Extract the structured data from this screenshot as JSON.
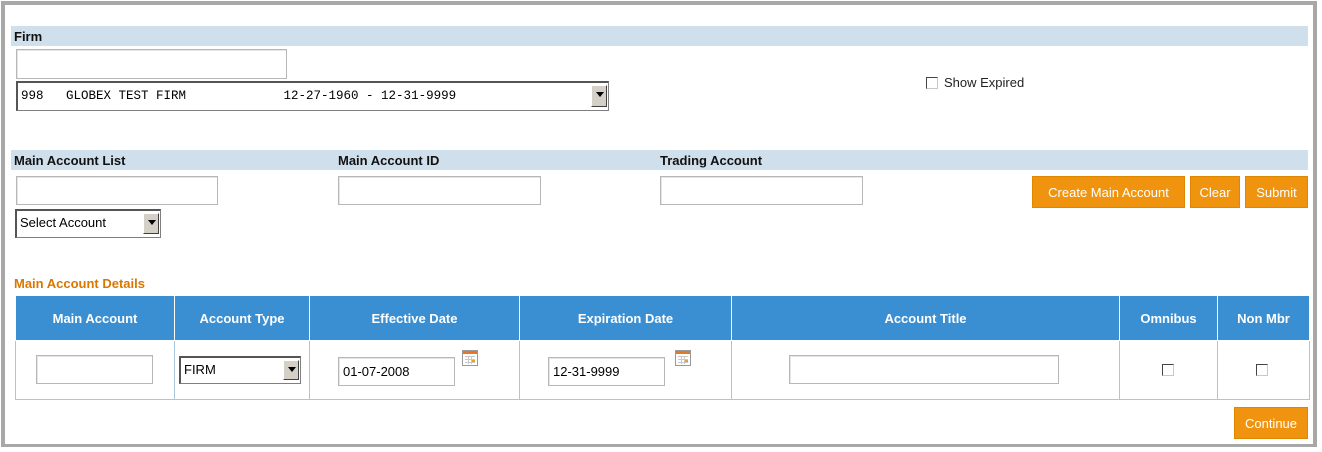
{
  "firm": {
    "label": "Firm",
    "search_value": "",
    "selected_firm": "998   GLOBEX TEST FIRM             12-27-1960 - 12-31-9999",
    "show_expired_label": "Show Expired",
    "show_expired_checked": false
  },
  "accounts": {
    "main_account_list_label": "Main Account List",
    "main_account_id_label": "Main Account ID",
    "trading_account_label": "Trading Account",
    "main_account_list_value": "",
    "main_account_id_value": "",
    "trading_account_value": "",
    "select_account": "Select Account",
    "buttons": {
      "create": "Create Main Account",
      "clear": "Clear",
      "submit": "Submit"
    }
  },
  "details": {
    "title": "Main Account Details",
    "columns": [
      "Main Account",
      "Account Type",
      "Effective Date",
      "Expiration Date",
      "Account Title",
      "Omnibus",
      "Non Mbr"
    ],
    "row": {
      "main_account": "",
      "account_type": "FIRM",
      "effective_date": "01-07-2008",
      "expiration_date": "12-31-9999",
      "account_title": "",
      "omnibus_checked": false,
      "non_mbr_checked": false
    },
    "continue_label": "Continue"
  },
  "icons": {
    "calendar": "calendar-icon",
    "dropdown": "chevron-down-icon"
  },
  "colors": {
    "band": "#cfdfeb",
    "header": "#3a8fd3",
    "button": "#f0940f",
    "section_title": "#d97700"
  }
}
